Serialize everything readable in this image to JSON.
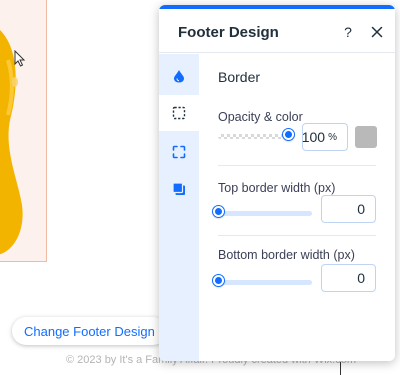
{
  "panel": {
    "title": "Footer Design",
    "help_label": "?",
    "section_title": "Border",
    "opacity": {
      "label": "Opacity & color",
      "value": "100",
      "unit": "%",
      "level": 1.0,
      "swatch_color": "#b9b9b9"
    },
    "top_border": {
      "label": "Top border width (px)",
      "value": "0",
      "level": 0.0
    },
    "bottom_border": {
      "label": "Bottom border width (px)",
      "value": "0",
      "level": 0.0
    },
    "side_tabs": [
      "fill-color-icon",
      "border-icon",
      "corners-icon",
      "shadow-icon"
    ],
    "active_tab": 1
  },
  "canvas": {
    "change_footer_button": "Change Footer Design",
    "footer_text": "© 2023 by It's a Family Affair. Proudly created with Wix.com"
  },
  "colors": {
    "accent": "#116dff",
    "tab_bar": "#e7f0ff",
    "drip": "#f3b400"
  }
}
